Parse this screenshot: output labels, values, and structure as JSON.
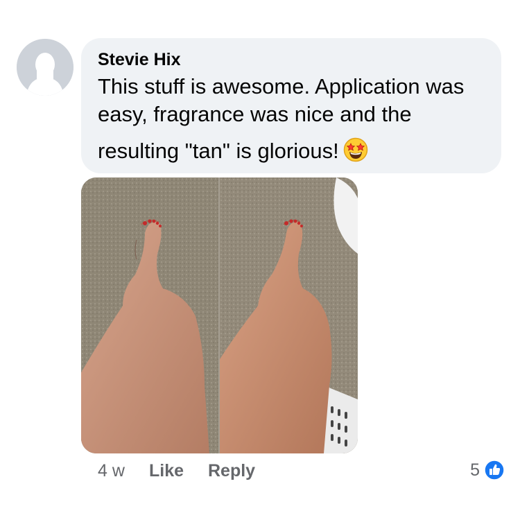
{
  "comment": {
    "author": "Stevie Hix",
    "text_lines": [
      "This stuff is awesome. Application was",
      "easy, fragrance was nice and the",
      "resulting \"tan\" is glorious!"
    ],
    "emoji": "star-struck-emoji"
  },
  "attachment": {
    "type": "photo-collage",
    "panels": 2
  },
  "actions": {
    "time": "4 w",
    "like_label": "Like",
    "reply_label": "Reply"
  },
  "reactions": {
    "count": "5",
    "icon": "thumbs-up-icon",
    "color": "#1877f2"
  },
  "colors": {
    "bubble": "#eff2f5",
    "meta_text": "#65676b"
  }
}
